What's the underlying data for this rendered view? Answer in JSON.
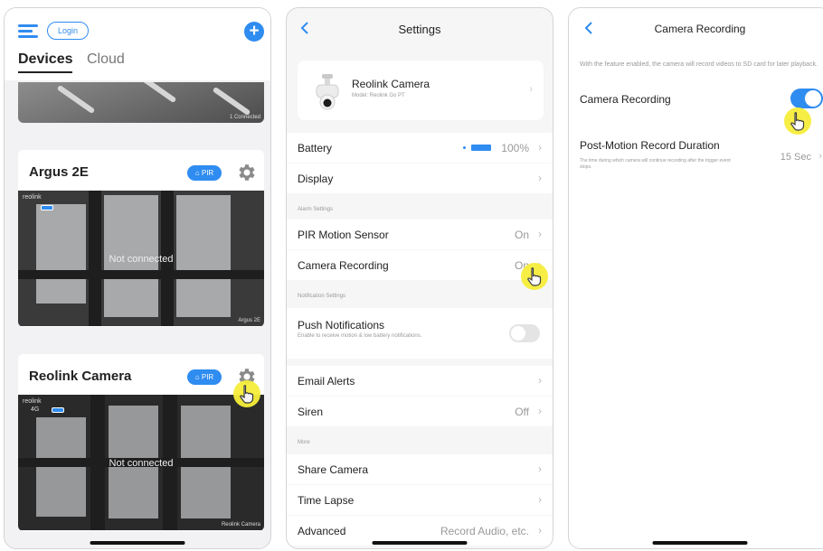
{
  "home": {
    "login_label": "Login",
    "add_symbol": "+",
    "tabs": [
      "Devices",
      "Cloud"
    ],
    "top_card_stamp": "1 Connected",
    "cards": [
      {
        "name": "Argus 2E",
        "badge": "PIR",
        "status": "Not connected",
        "brand": "reolink",
        "stamp": "Argus 2E"
      },
      {
        "name": "Reolink Camera",
        "badge": "PIR",
        "status": "Not connected",
        "brand": "reolink",
        "signal": "4G",
        "stamp": "Reolink Camera"
      }
    ]
  },
  "settings": {
    "title": "Settings",
    "device_name": "Reolink Camera",
    "device_model": "Model: Reolink Go PT",
    "rows": {
      "battery": {
        "label": "Battery",
        "value": "100%"
      },
      "display": {
        "label": "Display"
      },
      "pir": {
        "label": "PIR Motion Sensor",
        "value": "On"
      },
      "recording": {
        "label": "Camera Recording",
        "value": "On"
      },
      "push": {
        "label": "Push Notifications",
        "sub": "Enable to receive motion & low battery notifications.",
        "toggle": false
      },
      "email": {
        "label": "Email Alerts"
      },
      "siren": {
        "label": "Siren",
        "value": "Off"
      },
      "share": {
        "label": "Share Camera"
      },
      "timelapse": {
        "label": "Time Lapse"
      },
      "advanced": {
        "label": "Advanced",
        "value": "Record Audio, etc."
      }
    },
    "sections": {
      "alarm": "Alarm Settings",
      "notification": "Notification Settings",
      "more": "More"
    }
  },
  "recording": {
    "title": "Camera Recording",
    "description": "With the feature enabled, the camera will record videos to SD card for later playback.",
    "toggle_label": "Camera Recording",
    "toggle_on": true,
    "duration_label": "Post-Motion Record Duration",
    "duration_sub": "The time during which camera will continue recording after the trigger event stops.",
    "duration_value": "15 Sec"
  },
  "colors": {
    "accent": "#2f8cf0",
    "highlight": "#f6ee3a"
  }
}
